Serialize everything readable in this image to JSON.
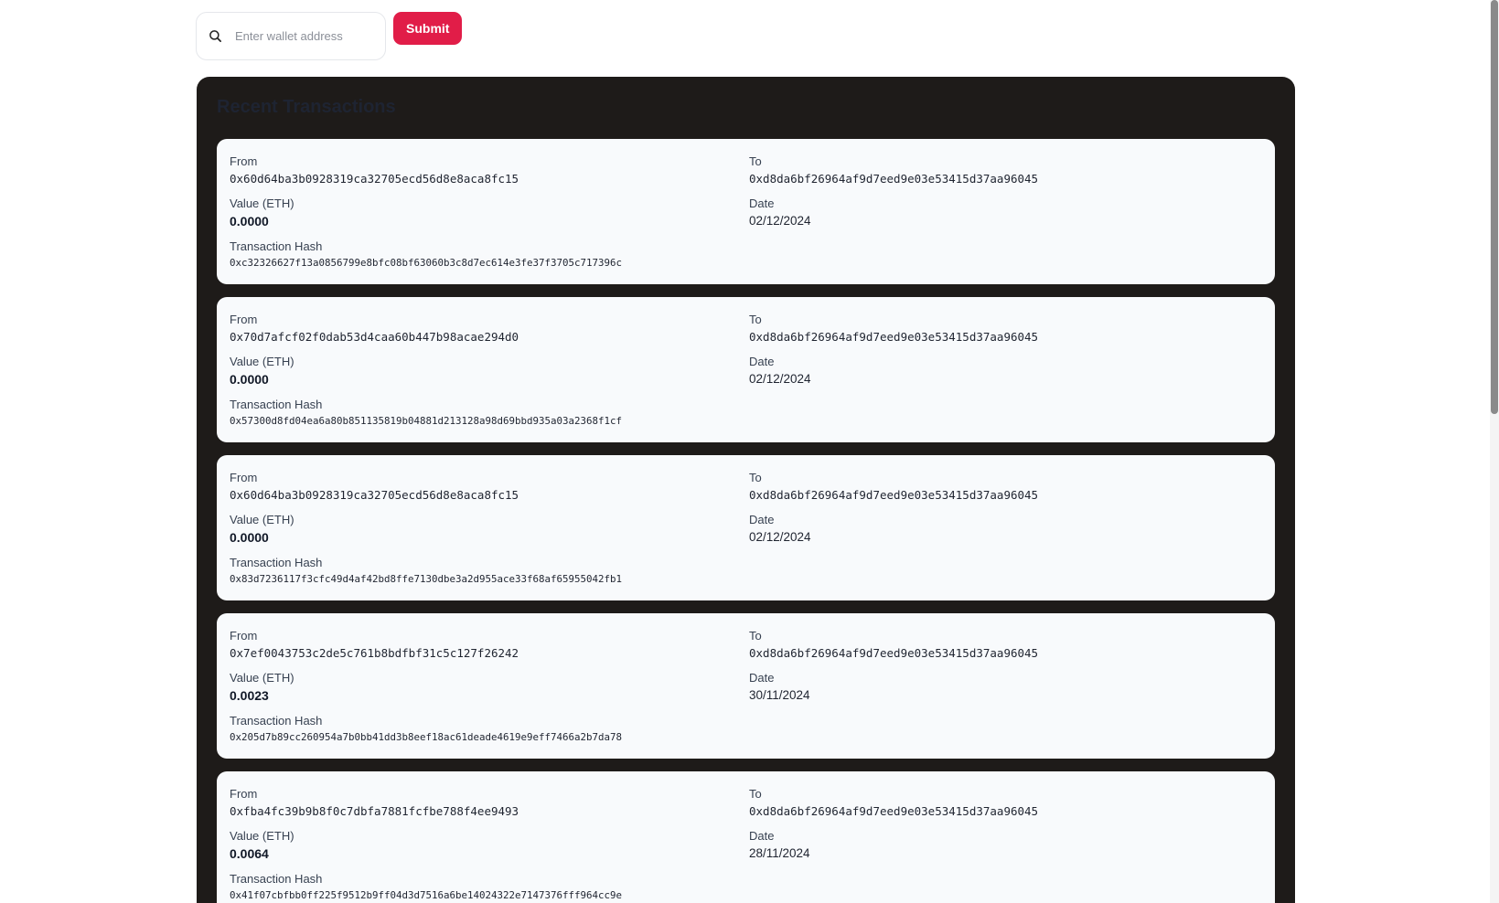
{
  "search": {
    "placeholder": "Enter wallet address",
    "icon": "search-icon",
    "submit_label": "Submit"
  },
  "colors": {
    "accent": "#e11d48",
    "panel_background": "#1e1b19",
    "card_background": "#f8fafc"
  },
  "panel": {
    "title": "Recent Transactions"
  },
  "labels": {
    "from": "From",
    "to": "To",
    "value": "Value (ETH)",
    "date": "Date",
    "hash": "Transaction Hash"
  },
  "transactions": [
    {
      "from": "0x60d64ba3b0928319ca32705ecd56d8e8aca8fc15",
      "to": "0xd8da6bf26964af9d7eed9e03e53415d37aa96045",
      "value": "0.0000",
      "date": "02/12/2024",
      "hash": "0xc32326627f13a0856799e8bfc08bf63060b3c8d7ec614e3fe37f3705c717396c"
    },
    {
      "from": "0x70d7afcf02f0dab53d4caa60b447b98acae294d0",
      "to": "0xd8da6bf26964af9d7eed9e03e53415d37aa96045",
      "value": "0.0000",
      "date": "02/12/2024",
      "hash": "0x57300d8fd04ea6a80b851135819b04881d213128a98d69bbd935a03a2368f1cf"
    },
    {
      "from": "0x60d64ba3b0928319ca32705ecd56d8e8aca8fc15",
      "to": "0xd8da6bf26964af9d7eed9e03e53415d37aa96045",
      "value": "0.0000",
      "date": "02/12/2024",
      "hash": "0x83d7236117f3cfc49d4af42bd8ffe7130dbe3a2d955ace33f68af65955042fb1"
    },
    {
      "from": "0x7ef0043753c2de5c761b8bdfbf31c5c127f26242",
      "to": "0xd8da6bf26964af9d7eed9e03e53415d37aa96045",
      "value": "0.0023",
      "date": "30/11/2024",
      "hash": "0x205d7b89cc260954a7b0bb41dd3b8eef18ac61deade4619e9eff7466a2b7da78"
    },
    {
      "from": "0xfba4fc39b9b8f0c7dbfa7881fcfbe788f4ee9493",
      "to": "0xd8da6bf26964af9d7eed9e03e53415d37aa96045",
      "value": "0.0064",
      "date": "28/11/2024",
      "hash": "0x41f07cbfbb0ff225f9512b9ff04d3d7516a6be14024322e7147376fff964cc9e"
    }
  ]
}
